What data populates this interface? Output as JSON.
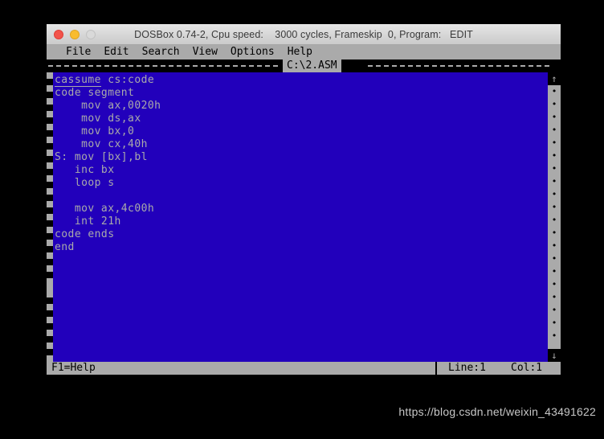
{
  "window": {
    "title": "DOSBox 0.74-2, Cpu speed:    3000 cycles, Frameskip  0, Program:   EDIT",
    "traffic_lights": {
      "close_label": "close-button",
      "minimize_label": "minimize-button",
      "zoom_label": "zoom-button"
    },
    "colors": {
      "titlebar_bg": "#d6d6d6",
      "dos_blue": "#2200bb",
      "dos_gray": "#aaaaaa",
      "dos_black": "#000000",
      "close_red": "#f2534a",
      "minimize_yellow": "#f9bc2e",
      "zoom_disabled": "#d9d9d9"
    }
  },
  "menu": {
    "items": [
      {
        "label": "File"
      },
      {
        "label": "Edit"
      },
      {
        "label": "Search"
      },
      {
        "label": "View"
      },
      {
        "label": "Options"
      },
      {
        "label": "Help"
      }
    ]
  },
  "document": {
    "title": "C:\\2.ASM",
    "corner_left": "╦",
    "corner_right": "╦"
  },
  "editor": {
    "lines": [
      {
        "text": "cassume cs:code",
        "cursor": true,
        "cursor_word": "cassume",
        "rest": " cs:code"
      },
      {
        "text": "code segment"
      },
      {
        "text": "    mov ax,0020h"
      },
      {
        "text": "    mov ds,ax"
      },
      {
        "text": "    mov bx,0"
      },
      {
        "text": "    mov cx,40h"
      },
      {
        "text": "S: mov [bx],bl"
      },
      {
        "text": "   inc bx"
      },
      {
        "text": "   loop s"
      },
      {
        "text": ""
      },
      {
        "text": "   mov ax,4c00h"
      },
      {
        "text": "   int 21h"
      },
      {
        "text": "code ends"
      },
      {
        "text": "end"
      }
    ]
  },
  "scrollbar": {
    "up_arrow": "↑",
    "down_arrow": "↓",
    "track_glyph": "•",
    "track_rows": 20
  },
  "status": {
    "help": "F1=Help",
    "line": "Line:1",
    "col": "Col:1"
  },
  "watermark": {
    "text": "https://blog.csdn.net/weixin_43491622"
  }
}
